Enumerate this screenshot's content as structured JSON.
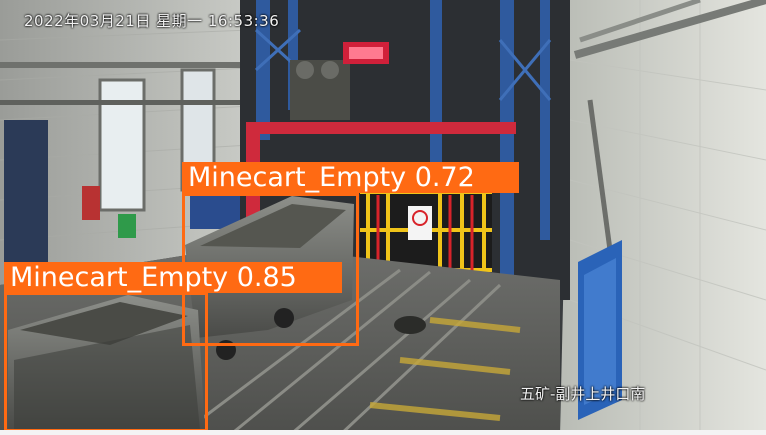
{
  "overlay": {
    "timestamp": "2022年03月21日  星期一  16:53:36",
    "location": "五矿-副井上井口南"
  },
  "detections": [
    {
      "label": "Minecart_Empty",
      "score": "0.72",
      "text": "Minecart_Empty  0.72"
    },
    {
      "label": "Minecart_Empty",
      "score": "0.85",
      "text": "Minecart_Empty  0.85"
    }
  ],
  "colors": {
    "detection_box": "#ff6a13",
    "overlay_text": "#f2f2f2"
  }
}
